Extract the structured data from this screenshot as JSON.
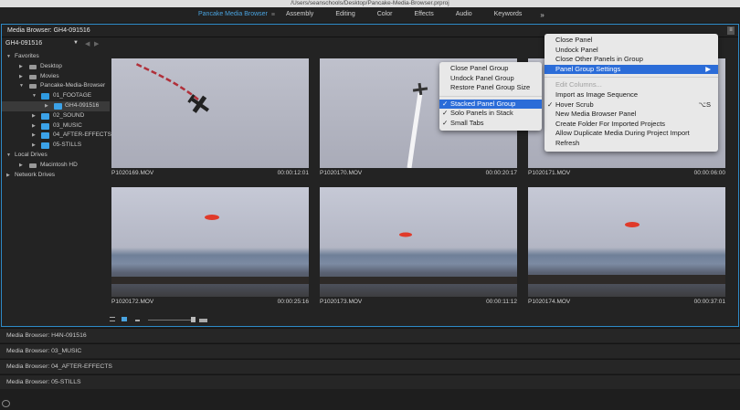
{
  "window": {
    "title": "/Users/seanschools/Desktop/Pancake-Media-Browser.prproj"
  },
  "workspaces": {
    "tabs": [
      "Pancake Media Browser",
      "Assembly",
      "Editing",
      "Color",
      "Effects",
      "Audio",
      "Keywords"
    ],
    "active_menu": "≡",
    "overflow": "»"
  },
  "panel": {
    "title": "Media Browser: GH4-091516",
    "location": "GH4-091516",
    "back": "◀",
    "forward": "▶"
  },
  "tree": {
    "favorites": "Favorites",
    "desktop": "Desktop",
    "movies": "Movies",
    "pancake": "Pancake-Media-Browser",
    "footage": "01_FOOTAGE",
    "gh4": "GH4-091516",
    "sound": "02_SOUND",
    "music": "03_MUSIC",
    "after_effects": "04_AFTER-EFFECTS",
    "stills": "05-STILLS",
    "local_drives": "Local Drives",
    "macintosh": "Macintosh HD",
    "network_drives": "Network Drives"
  },
  "clips": [
    {
      "name": "P1020169.MOV",
      "duration": "00:00:12:01",
      "kind": "sky"
    },
    {
      "name": "P1020170.MOV",
      "duration": "00:00:20:17",
      "kind": "sky"
    },
    {
      "name": "P1020171.MOV",
      "duration": "00:00:06:00",
      "kind": "sky"
    },
    {
      "name": "P1020172.MOV",
      "duration": "00:00:25:16",
      "kind": "beach"
    },
    {
      "name": "P1020173.MOV",
      "duration": "00:00:11:12",
      "kind": "beach"
    },
    {
      "name": "P1020174.MOV",
      "duration": "00:00:37:01",
      "kind": "beach"
    }
  ],
  "stacked_panels": [
    "Media Browser: H4N-091516",
    "Media Browser: 03_MUSIC",
    "Media Browser: 04_AFTER-EFFECTS",
    "Media Browser: 05-STILLS"
  ],
  "panel_menu": {
    "items": [
      "Close Panel",
      "Undock Panel",
      "Close Other Panels in Group",
      "Panel Group Settings"
    ],
    "submenu_arrow": "▶",
    "edit_columns": "Edit Columns...",
    "import_sequence": "Import as Image Sequence",
    "hover_scrub": "Hover Scrub",
    "hover_shortcut": "⌥S",
    "new_browser": "New Media Browser Panel",
    "create_folder": "Create Folder For Imported Projects",
    "allow_duplicate": "Allow Duplicate Media During Project Import",
    "refresh": "Refresh",
    "check": "✓"
  },
  "group_menu": {
    "close_group": "Close Panel Group",
    "undock_group": "Undock Panel Group",
    "restore_size": "Restore Panel Group Size",
    "stacked": "Stacked Panel Group",
    "solo": "Solo Panels in Stack",
    "small_tabs": "Small Tabs",
    "check": "✓"
  },
  "colors": {
    "accent": "#2d8ac7",
    "folder": "#3ba2e8",
    "menu_highlight": "#2b6cd8",
    "helicopter": "#e03a2a"
  }
}
